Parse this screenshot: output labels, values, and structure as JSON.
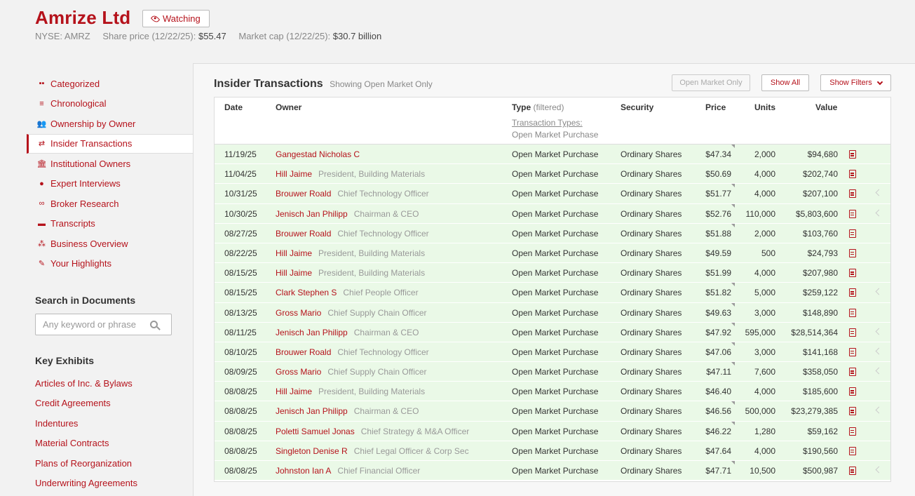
{
  "company": {
    "name": "Amrize Ltd",
    "watch_label": "Watching",
    "ticker": "NYSE: AMRZ",
    "price_label": "Share price (12/22/25):",
    "price_value": "$55.47",
    "cap_label": "Market cap (12/22/25):",
    "cap_value": "$30.7 billion"
  },
  "sidebar": {
    "items": [
      {
        "label": "Categorized",
        "icon": "grid-icon"
      },
      {
        "label": "Chronological",
        "icon": "list-icon"
      },
      {
        "label": "Ownership by Owner",
        "icon": "users-icon"
      },
      {
        "label": "Insider Transactions",
        "icon": "swap-icon",
        "active": true
      },
      {
        "label": "Institutional Owners",
        "icon": "bank-icon"
      },
      {
        "label": "Expert Interviews",
        "icon": "person-icon"
      },
      {
        "label": "Broker Research",
        "icon": "binoculars-icon"
      },
      {
        "label": "Transcripts",
        "icon": "comment-icon"
      },
      {
        "label": "Business Overview",
        "icon": "sitemap-icon"
      },
      {
        "label": "Your Highlights",
        "icon": "pencil-icon"
      }
    ]
  },
  "search": {
    "title": "Search in Documents",
    "placeholder": "Any keyword or phrase"
  },
  "exhibits": {
    "title": "Key Exhibits",
    "items": [
      "Articles of Inc. & Bylaws",
      "Credit Agreements",
      "Indentures",
      "Material Contracts",
      "Plans of Reorganization",
      "Underwriting Agreements"
    ]
  },
  "panel": {
    "title": "Insider Transactions",
    "subtitle": "Showing Open Market Only",
    "btn_open_market": "Open Market Only",
    "btn_show_all": "Show All",
    "btn_show_filters": "Show Filters"
  },
  "table": {
    "headers": {
      "date": "Date",
      "owner": "Owner",
      "type": "Type",
      "type_filter": "(filtered)",
      "security": "Security",
      "price": "Price",
      "units": "Units",
      "value": "Value"
    },
    "type_link": "Transaction Types:",
    "type_value": "Open Market Purchase",
    "rows": [
      {
        "date": "11/19/25",
        "owner": "Gangestad Nicholas C",
        "title": "",
        "type": "Open Market Purchase",
        "security": "Ordinary Shares",
        "price": "$47.34",
        "units": "2,000",
        "value": "$94,680",
        "corner": true,
        "arrow": false
      },
      {
        "date": "11/04/25",
        "owner": "Hill Jaime",
        "title": "President, Building Materials",
        "type": "Open Market Purchase",
        "security": "Ordinary Shares",
        "price": "$50.69",
        "units": "4,000",
        "value": "$202,740",
        "corner": false,
        "arrow": false
      },
      {
        "date": "10/31/25",
        "owner": "Brouwer Roald",
        "title": "Chief Technology Officer",
        "type": "Open Market Purchase",
        "security": "Ordinary Shares",
        "price": "$51.77",
        "units": "4,000",
        "value": "$207,100",
        "corner": true,
        "arrow": true
      },
      {
        "date": "10/30/25",
        "owner": "Jenisch Jan Philipp",
        "title": "Chairman & CEO",
        "type": "Open Market Purchase",
        "security": "Ordinary Shares",
        "price": "$52.76",
        "units": "110,000",
        "value": "$5,803,600",
        "corner": true,
        "arrow": true
      },
      {
        "date": "08/27/25",
        "owner": "Brouwer Roald",
        "title": "Chief Technology Officer",
        "type": "Open Market Purchase",
        "security": "Ordinary Shares",
        "price": "$51.88",
        "units": "2,000",
        "value": "$103,760",
        "corner": true,
        "arrow": false
      },
      {
        "date": "08/22/25",
        "owner": "Hill Jaime",
        "title": "President, Building Materials",
        "type": "Open Market Purchase",
        "security": "Ordinary Shares",
        "price": "$49.59",
        "units": "500",
        "value": "$24,793",
        "corner": false,
        "arrow": false
      },
      {
        "date": "08/15/25",
        "owner": "Hill Jaime",
        "title": "President, Building Materials",
        "type": "Open Market Purchase",
        "security": "Ordinary Shares",
        "price": "$51.99",
        "units": "4,000",
        "value": "$207,980",
        "corner": false,
        "arrow": false
      },
      {
        "date": "08/15/25",
        "owner": "Clark Stephen S",
        "title": "Chief People Officer",
        "type": "Open Market Purchase",
        "security": "Ordinary Shares",
        "price": "$51.82",
        "units": "5,000",
        "value": "$259,122",
        "corner": true,
        "arrow": true
      },
      {
        "date": "08/13/25",
        "owner": "Gross Mario",
        "title": "Chief Supply Chain Officer",
        "type": "Open Market Purchase",
        "security": "Ordinary Shares",
        "price": "$49.63",
        "units": "3,000",
        "value": "$148,890",
        "corner": true,
        "arrow": false
      },
      {
        "date": "08/11/25",
        "owner": "Jenisch Jan Philipp",
        "title": "Chairman & CEO",
        "type": "Open Market Purchase",
        "security": "Ordinary Shares",
        "price": "$47.92",
        "units": "595,000",
        "value": "$28,514,364",
        "corner": true,
        "arrow": true
      },
      {
        "date": "08/10/25",
        "owner": "Brouwer Roald",
        "title": "Chief Technology Officer",
        "type": "Open Market Purchase",
        "security": "Ordinary Shares",
        "price": "$47.06",
        "units": "3,000",
        "value": "$141,168",
        "corner": true,
        "arrow": true
      },
      {
        "date": "08/09/25",
        "owner": "Gross Mario",
        "title": "Chief Supply Chain Officer",
        "type": "Open Market Purchase",
        "security": "Ordinary Shares",
        "price": "$47.11",
        "units": "7,600",
        "value": "$358,050",
        "corner": true,
        "arrow": true
      },
      {
        "date": "08/08/25",
        "owner": "Hill Jaime",
        "title": "President, Building Materials",
        "type": "Open Market Purchase",
        "security": "Ordinary Shares",
        "price": "$46.40",
        "units": "4,000",
        "value": "$185,600",
        "corner": false,
        "arrow": false
      },
      {
        "date": "08/08/25",
        "owner": "Jenisch Jan Philipp",
        "title": "Chairman & CEO",
        "type": "Open Market Purchase",
        "security": "Ordinary Shares",
        "price": "$46.56",
        "units": "500,000",
        "value": "$23,279,385",
        "corner": true,
        "arrow": true
      },
      {
        "date": "08/08/25",
        "owner": "Poletti Samuel Jonas",
        "title": "Chief Strategy & M&A Officer",
        "type": "Open Market Purchase",
        "security": "Ordinary Shares",
        "price": "$46.22",
        "units": "1,280",
        "value": "$59,162",
        "corner": true,
        "arrow": false
      },
      {
        "date": "08/08/25",
        "owner": "Singleton Denise R",
        "title": "Chief Legal Officer & Corp Sec",
        "type": "Open Market Purchase",
        "security": "Ordinary Shares",
        "price": "$47.64",
        "units": "4,000",
        "value": "$190,560",
        "corner": false,
        "arrow": false
      },
      {
        "date": "08/08/25",
        "owner": "Johnston Ian A",
        "title": "Chief Financial Officer",
        "type": "Open Market Purchase",
        "security": "Ordinary Shares",
        "price": "$47.71",
        "units": "10,500",
        "value": "$500,987",
        "corner": true,
        "arrow": true
      }
    ]
  }
}
